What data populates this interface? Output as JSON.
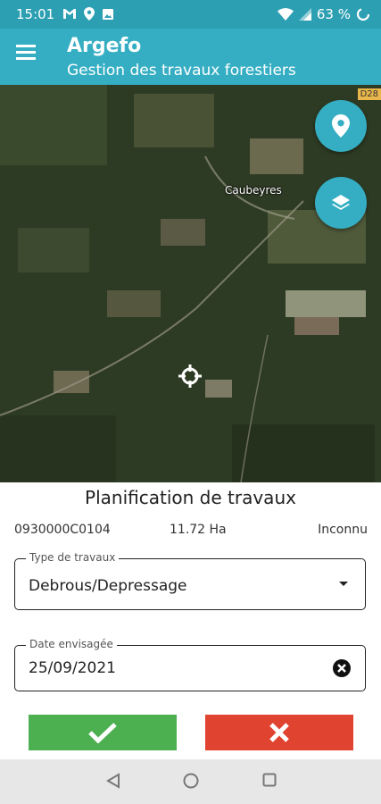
{
  "status": {
    "time": "15:01",
    "battery": "63 %"
  },
  "appbar": {
    "title": "Argefo",
    "subtitle": "Gestion des travaux forestiers"
  },
  "map": {
    "place_label": "Caubeyres",
    "road_label": "D28"
  },
  "panel": {
    "title": "Planification de travaux",
    "parcel_id": "0930000C0104",
    "area": "11.72 Ha",
    "status": "Inconnu",
    "type_field": {
      "label": "Type de travaux",
      "value": "Debrous/Depressage"
    },
    "date_field": {
      "label": "Date envisagée",
      "value": "25/09/2021"
    }
  },
  "colors": {
    "accent": "#35aec3",
    "statusbar": "#2c9fb2",
    "confirm": "#4caf50",
    "cancel": "#e0432f"
  }
}
